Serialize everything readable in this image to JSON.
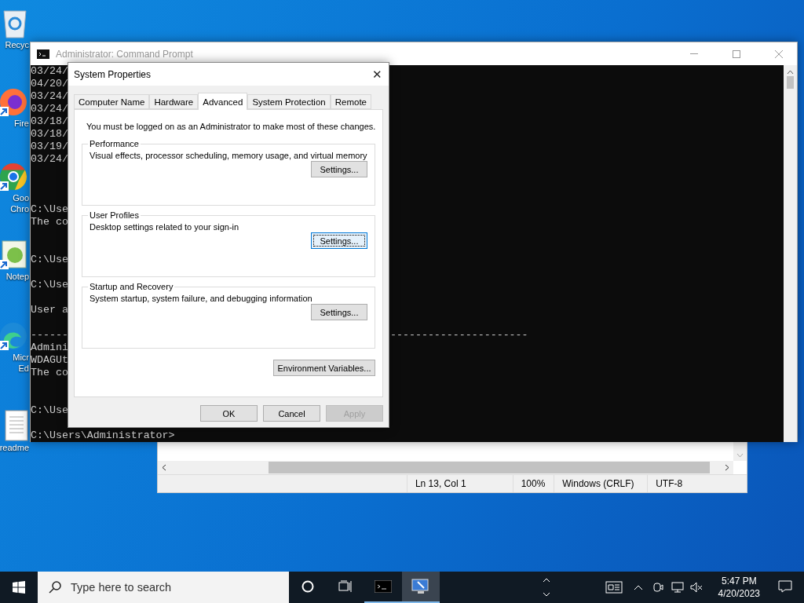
{
  "desktop_icons": [
    {
      "kind": "recycle",
      "lines": [
        "Recyc"
      ]
    },
    {
      "kind": "firefox",
      "lines": [
        "Fire"
      ]
    },
    {
      "kind": "chrome",
      "lines": [
        "Goo",
        "Chro"
      ]
    },
    {
      "kind": "notepad",
      "lines": [
        "Notep"
      ]
    },
    {
      "kind": "edge",
      "lines": [
        "Micr",
        "Ed"
      ]
    },
    {
      "kind": "document",
      "lines": [
        "readme"
      ]
    }
  ],
  "command_prompt": {
    "title": "Administrator: Command Prompt",
    "active": false,
    "lines": [
      {
        "kind": "text",
        "text": "03/24/"
      },
      {
        "kind": "text",
        "text": "04/20/"
      },
      {
        "kind": "text",
        "text": "03/24/"
      },
      {
        "kind": "text",
        "text": "03/24/"
      },
      {
        "kind": "text",
        "text": "03/18/"
      },
      {
        "kind": "text",
        "text": "03/18/"
      },
      {
        "kind": "text",
        "text": "03/19/"
      },
      {
        "kind": "text",
        "text": "03/24/"
      },
      {
        "kind": "blank"
      },
      {
        "kind": "blank"
      },
      {
        "kind": "blank"
      },
      {
        "kind": "text",
        "text": "C:\\Use"
      },
      {
        "kind": "text",
        "text": "The co"
      },
      {
        "kind": "blank"
      },
      {
        "kind": "blank"
      },
      {
        "kind": "text",
        "text": "C:\\Use"
      },
      {
        "kind": "blank"
      },
      {
        "kind": "text",
        "text": "C:\\Use"
      },
      {
        "kind": "blank"
      },
      {
        "kind": "text",
        "text": "User a"
      },
      {
        "kind": "blank"
      },
      {
        "kind": "text",
        "text": "------",
        "right_text": "----------------------"
      },
      {
        "kind": "text",
        "text": "Admini"
      },
      {
        "kind": "text",
        "text": "WDAGUt"
      },
      {
        "kind": "text",
        "text": "The co"
      },
      {
        "kind": "blank"
      },
      {
        "kind": "blank"
      },
      {
        "kind": "text",
        "text": "C:\\Use"
      },
      {
        "kind": "blank"
      },
      {
        "kind": "text",
        "text": "C:\\Users\\Administrator>"
      }
    ]
  },
  "notepad": {
    "status_bar": [
      "Ln 13, Col 1",
      "100%",
      "Windows (CRLF)",
      "UTF-8"
    ]
  },
  "dialog": {
    "title": "System Properties",
    "close": "✕",
    "tabs": [
      {
        "label": "Computer Name",
        "selected": false
      },
      {
        "label": "Hardware",
        "selected": false
      },
      {
        "label": "Advanced",
        "selected": true
      },
      {
        "label": "System Protection",
        "selected": false
      },
      {
        "label": "Remote",
        "selected": false
      }
    ],
    "notice": "You must be logged on as an Administrator to make most of these changes.",
    "groups": [
      {
        "title": "Performance",
        "description": "Visual effects, processor scheduling, memory usage, and virtual memory",
        "button": "Settings...",
        "focused": false
      },
      {
        "title": "User Profiles",
        "description": "Desktop settings related to your sign-in",
        "button": "Settings...",
        "focused": true
      },
      {
        "title": "Startup and Recovery",
        "description": "System startup, system failure, and debugging information",
        "button": "Settings...",
        "focused": false
      }
    ],
    "environment_button": "Environment Variables...",
    "buttons": [
      {
        "label": "OK",
        "disabled": false
      },
      {
        "label": "Cancel",
        "disabled": false
      },
      {
        "label": "Apply",
        "disabled": true
      }
    ]
  },
  "taskbar": {
    "search_placeholder": "Type here to search",
    "apps": [
      {
        "kind": "terminal",
        "selected": false
      },
      {
        "kind": "system",
        "selected": true
      }
    ],
    "time": "5:47 PM",
    "date": "4/20/2023"
  }
}
